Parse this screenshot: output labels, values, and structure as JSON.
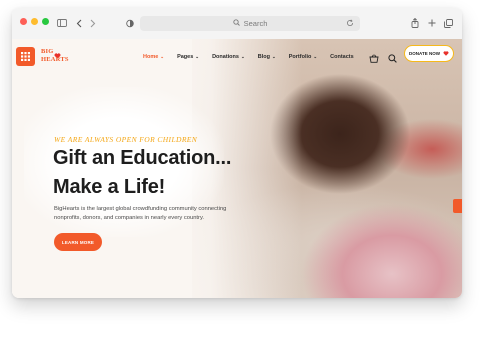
{
  "browser": {
    "search_placeholder": "Search",
    "icons": [
      "sidebar-icon",
      "back-icon",
      "forward-icon",
      "shield-icon",
      "search-icon",
      "reload-icon",
      "share-icon",
      "new-tab-icon",
      "tabs-icon"
    ]
  },
  "site": {
    "logo": {
      "line1": "BIG",
      "line2": "HEARTS"
    },
    "nav": [
      {
        "label": "Home",
        "active": true,
        "has_dropdown": true
      },
      {
        "label": "Pages",
        "has_dropdown": true
      },
      {
        "label": "Donations",
        "has_dropdown": true
      },
      {
        "label": "Blog",
        "has_dropdown": true
      },
      {
        "label": "Portfolio",
        "has_dropdown": true
      },
      {
        "label": "Contacts",
        "has_dropdown": false
      }
    ],
    "donate_label": "DONATE NOW",
    "hero": {
      "tagline": "WE ARE ALWAYS OPEN FOR CHILDREN",
      "headline_line1": "Gift an Education...",
      "headline_line2": "Make a Life!",
      "description": "BigHearts is the largest global crowdfunding community connecting nonprofits, donors, and companies in nearly every country.",
      "cta_label": "LEARN MORE"
    }
  },
  "colors": {
    "accent": "#f25a2a",
    "tagline": "#f4a716",
    "donate_border": "#f6b91b",
    "heading": "#1e1e1e",
    "background": "#faf6f2"
  }
}
